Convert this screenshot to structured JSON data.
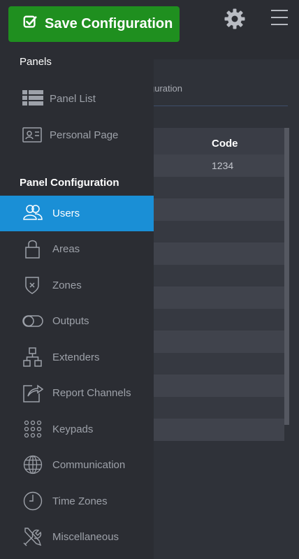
{
  "header": {
    "save_label": "Save Configuration"
  },
  "main": {
    "breadcrumb": "guration",
    "table": {
      "code_header": "Code",
      "rows": [
        "1234",
        "",
        "",
        "",
        "",
        "",
        "",
        "",
        "",
        "",
        "",
        "",
        ""
      ]
    }
  },
  "sidebar": {
    "panels_title": "Panels",
    "panels_items": [
      {
        "label": "Panel List",
        "icon": "list-icon"
      },
      {
        "label": "Personal Page",
        "icon": "id-card-icon"
      }
    ],
    "config_title": "Panel Configuration",
    "config_items": [
      {
        "label": "Users",
        "icon": "users-icon",
        "active": true
      },
      {
        "label": "Areas",
        "icon": "lock-icon"
      },
      {
        "label": "Zones",
        "icon": "shield-icon"
      },
      {
        "label": "Outputs",
        "icon": "toggle-icon"
      },
      {
        "label": "Extenders",
        "icon": "network-icon"
      },
      {
        "label": "Report Channels",
        "icon": "export-icon"
      },
      {
        "label": "Keypads",
        "icon": "keypad-icon"
      },
      {
        "label": "Communication",
        "icon": "globe-icon"
      },
      {
        "label": "Time Zones",
        "icon": "clock-icon"
      },
      {
        "label": "Miscellaneous",
        "icon": "tools-icon"
      }
    ]
  },
  "colors": {
    "accent": "#1a8fd6",
    "save_green": "#1f8f1f",
    "background": "#2b2d33"
  }
}
